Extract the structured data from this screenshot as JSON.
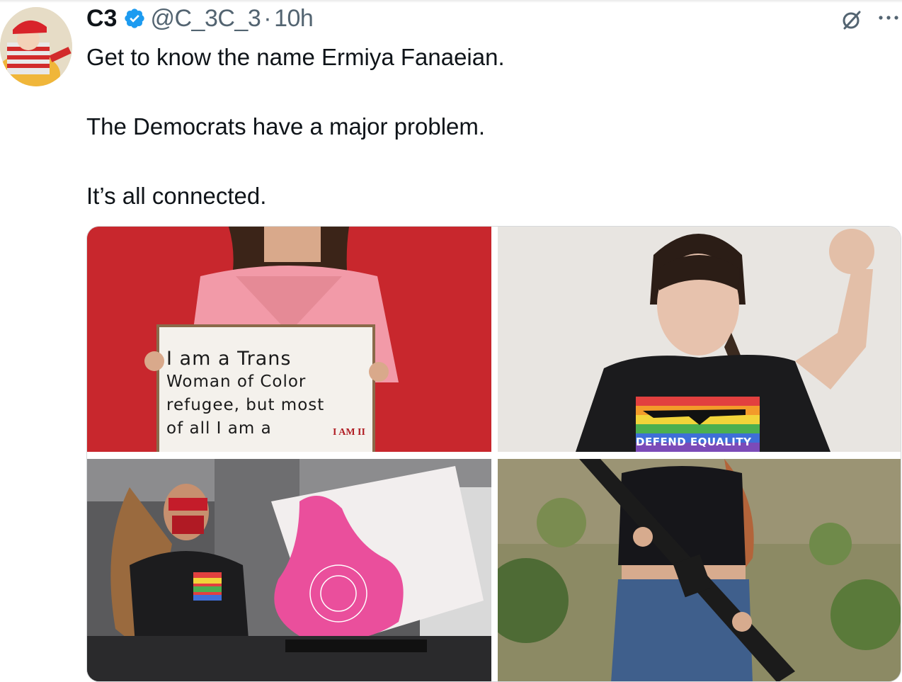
{
  "tweet": {
    "author_name": "C3",
    "handle": "@C_3C_3",
    "separator": "·",
    "time": "10h",
    "text": [
      "Get to know the name Ermiya Fanaeian.",
      "The Democrats have a major problem.",
      "It’s all connected."
    ]
  },
  "icons": {
    "verified": "verified-badge-icon",
    "grok": "grok-icon",
    "more": "more-dots-icon",
    "verified_color": "#1d9bf0"
  },
  "media": {
    "photo1": {
      "sign_lines": [
        "I am a Trans",
        "Woman of Color",
        "refugee, but most",
        "of all I am a"
      ],
      "sign_logo": "I AM II"
    },
    "photo2": {
      "shirt_text": "DEFEND EQUALITY"
    }
  }
}
